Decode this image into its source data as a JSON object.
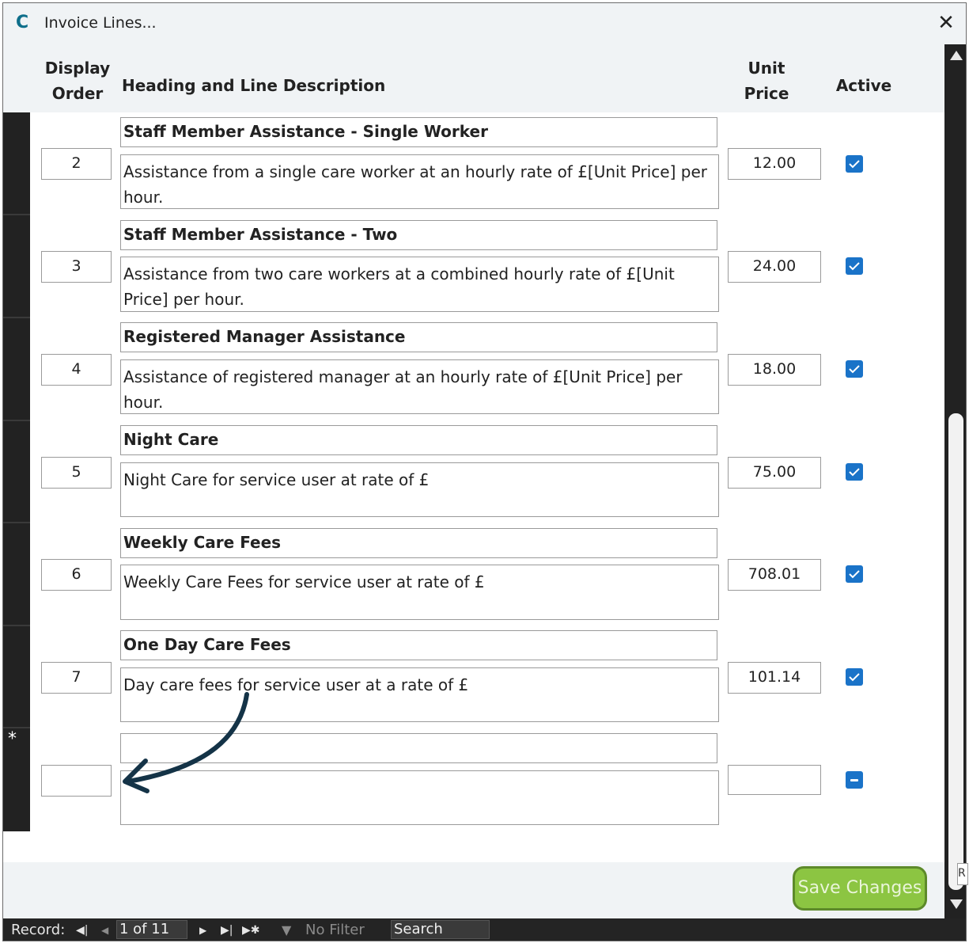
{
  "window": {
    "title": "Invoice Lines...",
    "app_icon": "C",
    "close_symbol": "✕"
  },
  "columns": {
    "display_order": [
      "Display",
      "Order"
    ],
    "heading_desc": "Heading and Line Description",
    "unit_price": [
      "Unit",
      "Price"
    ],
    "active": "Active"
  },
  "rows": [
    {
      "order": "2",
      "heading": "Staff Member Assistance - Single Worker",
      "description": "Assistance from a single care worker at an hourly rate of £[Unit Price] per hour.",
      "price": "12.00",
      "active": true
    },
    {
      "order": "3",
      "heading": "Staff Member Assistance - Two",
      "description": "Assistance from two care workers at a combined hourly rate of £[Unit Price] per hour.",
      "price": "24.00",
      "active": true
    },
    {
      "order": "4",
      "heading": "Registered Manager Assistance",
      "description": "Assistance of registered manager at an hourly rate of £[Unit Price] per hour.",
      "price": "18.00",
      "active": true
    },
    {
      "order": "5",
      "heading": "Night Care",
      "description": "Night Care for service user at rate of £",
      "price": "75.00",
      "active": true
    },
    {
      "order": "6",
      "heading": "Weekly Care Fees",
      "description": "Weekly Care Fees for service user at rate of £",
      "price": "708.01",
      "active": true
    },
    {
      "order": "7",
      "heading": "One Day Care Fees",
      "description": "Day care fees for service user at a rate of £",
      "price": "101.14",
      "active": true
    }
  ],
  "new_record_marker": "*",
  "save_button": "Save Changes",
  "navigation": {
    "record_label": "Record:",
    "first_icon": "first-record-icon",
    "prev_icon": "prev-record-icon",
    "position": "1 of 11",
    "next_icon": "next-record-icon",
    "last_icon": "last-record-icon",
    "new_icon": "new-record-icon",
    "filter": "No Filter",
    "search": "Search"
  },
  "side_peek": "R",
  "colors": {
    "checkbox": "#1a73c8",
    "save_button": "#8cc542",
    "save_border": "#5d8a2a",
    "arrow": "#143347"
  }
}
